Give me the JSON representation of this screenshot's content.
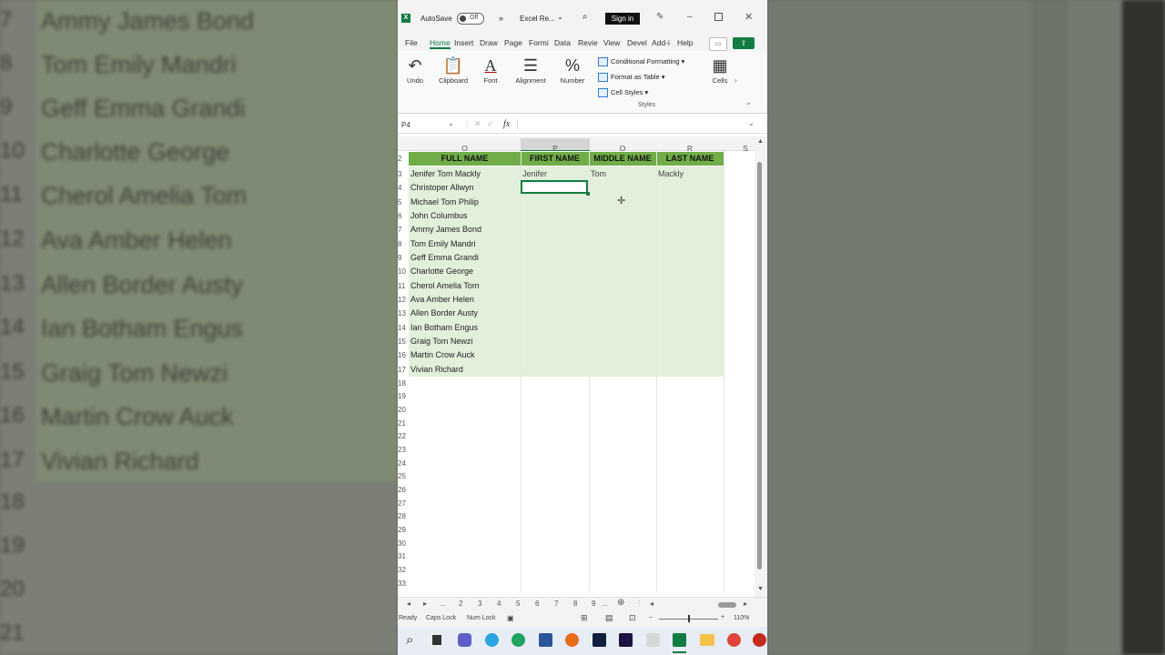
{
  "background": {
    "names": [
      "Ammy James Bond",
      "Tom Emily Mandri",
      "Geff Emma Grandi",
      "Charlotte George",
      "Cherol Amelia Tom",
      "Ava Amber Helen",
      "Allen Border Austy",
      "Ian Botham Engus",
      "Graig Tom Newzi",
      "Martin Crow Auck",
      "Vivian Richard"
    ],
    "row_numbers": [
      "7",
      "8",
      "9",
      "10",
      "11",
      "12",
      "13",
      "14",
      "15",
      "16",
      "17",
      "18",
      "19",
      "20",
      "21"
    ]
  },
  "titlebar": {
    "autosave_label": "AutoSave",
    "autosave_state": "Off",
    "more": "»",
    "file_name": "Excel Re...",
    "signin": "Sign in"
  },
  "ribbon_tabs": [
    "File",
    "Home",
    "Insert",
    "Draw",
    "Page",
    "Formi",
    "Data",
    "Revie",
    "View",
    "Devel",
    "Add-i",
    "Help"
  ],
  "ribbon": {
    "undo": "Undo",
    "clipboard": "Clipboard",
    "font": "Font",
    "alignment": "Alignment",
    "number": "Number",
    "conditional_formatting": "Conditional Formatting",
    "format_as_table": "Format as Table",
    "cell_styles": "Cell Styles",
    "styles_group": "Styles",
    "cells": "Cells"
  },
  "formula_bar": {
    "name_box": "P4",
    "fx": "fx",
    "value": ""
  },
  "grid": {
    "columns": [
      "O",
      "P",
      "Q",
      "R",
      "S"
    ],
    "headers": {
      "full": "FULL NAME",
      "first": "FIRST NAME",
      "middle": "MIDDLE NAME",
      "last": "LAST NAME"
    },
    "row_numbers": [
      "2",
      "3",
      "4",
      "5",
      "6",
      "7",
      "8",
      "9",
      "10",
      "11",
      "12",
      "13",
      "14",
      "15",
      "16",
      "17",
      "18",
      "19",
      "20",
      "21",
      "22",
      "23",
      "24",
      "25",
      "26",
      "27",
      "28",
      "29",
      "30",
      "31",
      "32",
      "33"
    ],
    "full_names": [
      "Jenifer Tom Mackly",
      "Christoper Allwyn",
      "Michael Tom Philip",
      "John Columbus",
      "Ammy James Bond",
      "Tom Emily Mandri",
      "Geff Emma Grandi",
      "Charlotte George",
      "Cherol Amelia Tom",
      "Ava Amber Helen",
      "Allen Border Austy",
      "Ian Botham Engus",
      "Graig Tom Newzi",
      "Martin Crow Auck",
      "Vivian Richard"
    ],
    "row3": {
      "first": "Jenifer",
      "middle": "Tom",
      "last": "Mackly"
    },
    "accent_header": "#70ad47",
    "accent_fill": "#e2efda"
  },
  "sheet_tabs": [
    "...",
    "2",
    "3",
    "4",
    "5",
    "6",
    "7",
    "8",
    "9",
    "..."
  ],
  "status": {
    "ready": "Ready",
    "caps": "Caps Lock",
    "num": "Num Lock",
    "zoom": "110%"
  }
}
